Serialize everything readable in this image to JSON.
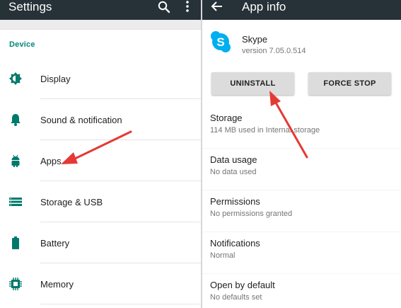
{
  "settings": {
    "title": "Settings",
    "section": "Device",
    "items": [
      {
        "label": "Display",
        "icon": "brightness-icon"
      },
      {
        "label": "Sound & notification",
        "icon": "bell-icon"
      },
      {
        "label": "Apps",
        "icon": "android-icon"
      },
      {
        "label": "Storage & USB",
        "icon": "storage-icon"
      },
      {
        "label": "Battery",
        "icon": "battery-icon"
      },
      {
        "label": "Memory",
        "icon": "memory-icon"
      }
    ]
  },
  "app_info": {
    "title": "App info",
    "app_name": "Skype",
    "version": "version 7.05.0.514",
    "buttons": {
      "uninstall": "UNINSTALL",
      "force_stop": "FORCE STOP"
    },
    "rows": [
      {
        "title": "Storage",
        "subtitle": "114 MB used in Internal storage"
      },
      {
        "title": "Data usage",
        "subtitle": "No data used"
      },
      {
        "title": "Permissions",
        "subtitle": "No permissions granted"
      },
      {
        "title": "Notifications",
        "subtitle": "Normal"
      },
      {
        "title": "Open by default",
        "subtitle": "No defaults set"
      }
    ]
  },
  "colors": {
    "toolbar": "#263238",
    "accent": "#00897b",
    "icon": "#00796b",
    "skype": "#00aff0",
    "annotation": "#e53935"
  }
}
